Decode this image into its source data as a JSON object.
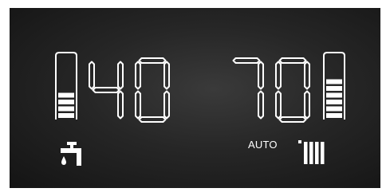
{
  "display": {
    "hot_water": {
      "temperature": "40",
      "level_bars_lit": 4,
      "level_bars_total": 8,
      "icon": "water-tap-icon"
    },
    "heating": {
      "temperature": "70",
      "level_bars_lit": 6,
      "level_bars_total": 8,
      "mode": "AUTO",
      "icon": "radiator-icon"
    }
  },
  "colors": {
    "background": "#1c1c1c",
    "segment": "#ffffff"
  }
}
